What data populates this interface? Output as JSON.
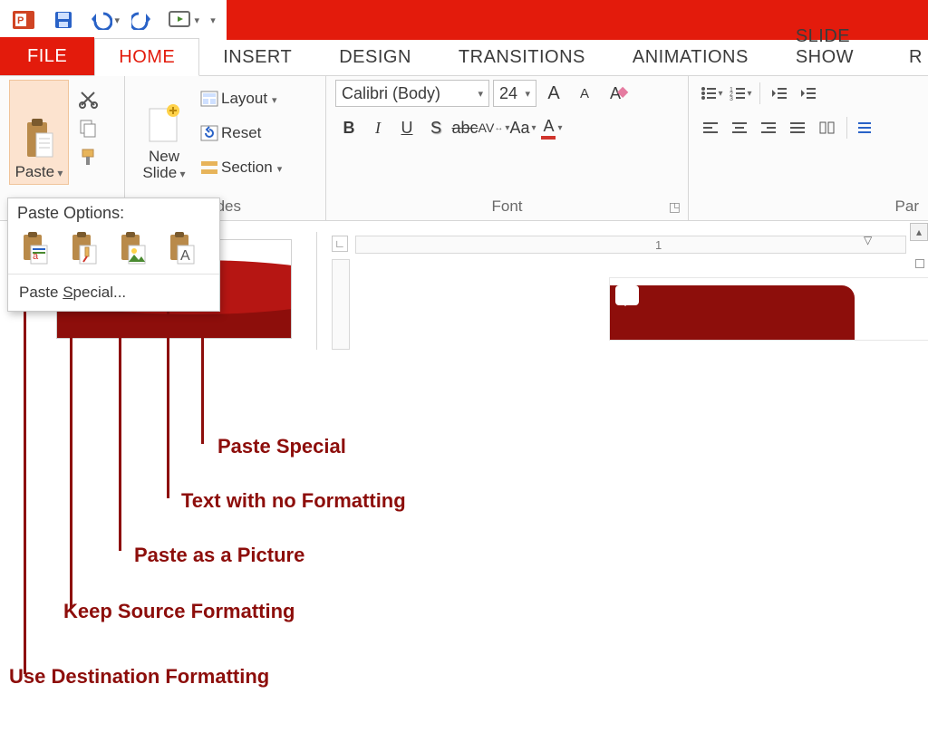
{
  "qat": {
    "save": "Save",
    "undo": "Undo",
    "redo": "Redo",
    "start": "Start From Beginning"
  },
  "tabs": {
    "file": "FILE",
    "home": "HOME",
    "insert": "INSERT",
    "design": "DESIGN",
    "transitions": "TRANSITIONS",
    "animations": "ANIMATIONS",
    "slideshow": "SLIDE SHOW",
    "review_initial": "R"
  },
  "clipboard": {
    "paste": "Paste",
    "cut": "Cut",
    "copy": "Copy",
    "painter": "Format Painter"
  },
  "slides": {
    "new_slide_l1": "New",
    "new_slide_l2": "Slide",
    "layout": "Layout",
    "reset": "Reset",
    "section": "Section",
    "group_label_full": "Slides",
    "group_label_visible": "lides"
  },
  "font": {
    "name": "Calibri (Body)",
    "size": "24",
    "grow": "A",
    "shrink": "A",
    "clear": "A",
    "bold": "B",
    "italic": "I",
    "underline": "U",
    "shadow": "S",
    "strike": "abc",
    "spacing": "AV",
    "case": "Aa",
    "color": "A",
    "group_label": "Font"
  },
  "paragraph": {
    "group_label_visible": "Par"
  },
  "paste_menu": {
    "header": "Paste Options:",
    "special_prefix": "Paste ",
    "special_u": "S",
    "special_suffix": "pecial..."
  },
  "ruler": {
    "one": "1"
  },
  "annotations": {
    "paste_special": "Paste Special",
    "text_no_fmt": "Text with no Formatting",
    "paste_picture": "Paste as a Picture",
    "keep_source": "Keep Source Formatting",
    "use_dest": "Use Destination Formatting"
  }
}
